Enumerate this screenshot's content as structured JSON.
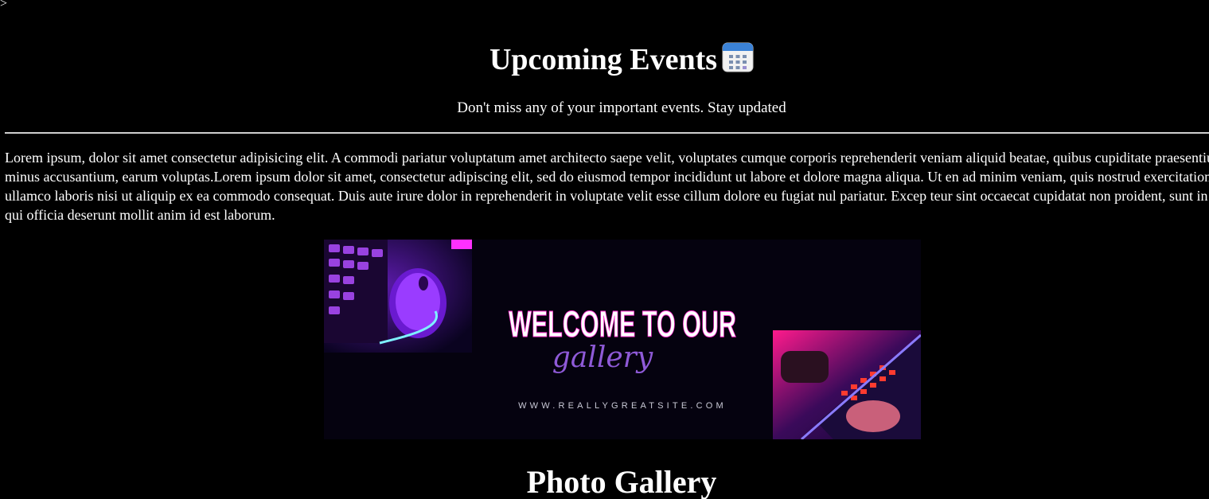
{
  "stray_text": ">",
  "header": {
    "title": "Upcoming Events",
    "subtitle": "Don't miss any of your important events. Stay updated",
    "title_icon": "calendar-icon"
  },
  "content": {
    "paragraph": "Lorem ipsum, dolor sit amet consectetur adipisicing elit. A commodi pariatur voluptatum amet architecto saepe velit, voluptates cumque corporis reprehenderit veniam aliquid beatae, quibus cupiditate praesentium minus accusantium, earum voluptas.Lorem ipsum dolor sit amet, consectetur adipiscing elit, sed do eiusmod tempor incididunt ut labore et dolore magna aliqua. Ut en ad minim veniam, quis nostrud exercitation ullamco laboris nisi ut aliquip ex ea commodo consequat. Duis aute irure dolor in reprehenderit in voluptate velit esse cillum dolore eu fugiat nul pariatur. Excep teur sint occaecat cupidatat non proident, sunt in culpa qui officia deserunt mollit anim id est laborum."
  },
  "banner": {
    "headline": "WELCOME TO OUR",
    "script_word": "gallery",
    "website": "WWW.REALLYGREATSITE.COM",
    "colors": {
      "background": "#05020f",
      "neon_purple": "#8a2be2",
      "neon_pink": "#ff1493",
      "script": "#8f5ad8"
    }
  },
  "gallery": {
    "title": "Photo Gallery"
  }
}
